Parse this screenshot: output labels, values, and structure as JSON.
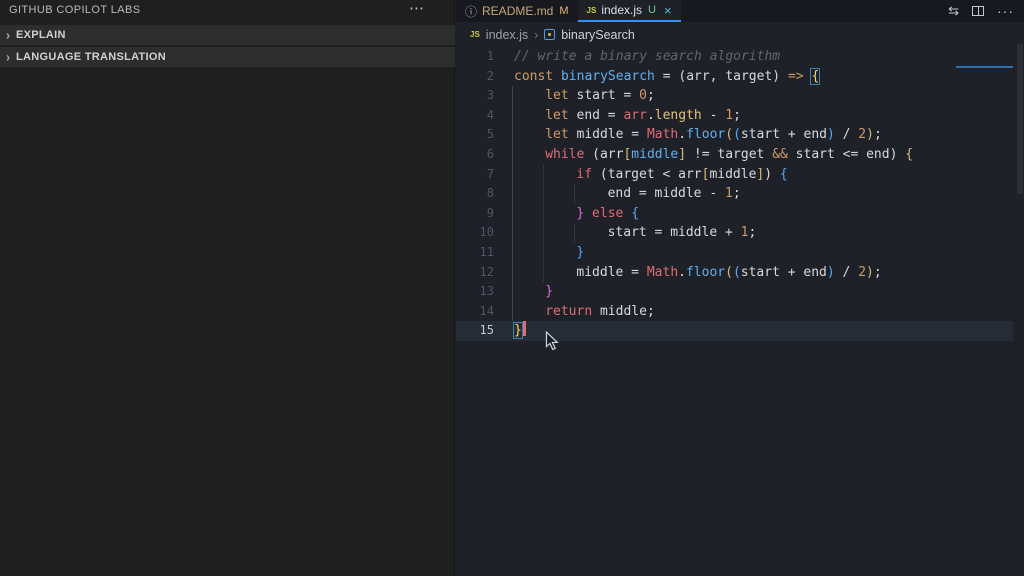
{
  "colors": {
    "accent": "#3193f5",
    "badge_modified": "#dfb77e",
    "badge_untracked": "#73c991",
    "close_icon": "#52b7d7",
    "token": {
      "comment": "#5f6672",
      "keyword": "#d19a66",
      "control": "#e06c75",
      "function": "#61afef",
      "property": "#e5c07b",
      "number": "#d19a66",
      "plain": "#d6d9de",
      "bracket1": "#d7ba7d",
      "bracket2": "#d670d6",
      "bracket3": "#58a6f5",
      "boxed": "#ffd75e",
      "cursor": "#e06c75"
    }
  },
  "sidebar": {
    "title": "GITHUB COPILOT LABS",
    "more_icon": "⋯",
    "chevron_icon": "›",
    "sections": [
      {
        "label": "EXPLAIN"
      },
      {
        "label": "LANGUAGE TRANSLATION"
      }
    ]
  },
  "tabs": [
    {
      "icon": "info",
      "icon_glyph": "ⓘ",
      "label": "README.md",
      "label_color": "#c5a679",
      "badge": "M",
      "badge_color": "#dfb77e",
      "active": false,
      "close": ""
    },
    {
      "icon": "js",
      "icon_glyph": "JS",
      "label": "index.js",
      "label_color": "#dde1e6",
      "badge": "U",
      "badge_color": "#73c991",
      "active": true,
      "close": "×"
    }
  ],
  "editor_actions": {
    "open_changes": "⇆",
    "more": "···"
  },
  "breadcrumb": {
    "file_icon": "JS",
    "file": "index.js",
    "separator": "›",
    "symbol": "binarySearch"
  },
  "code": {
    "active_line": 15,
    "lines": [
      {
        "n": 1,
        "indent": 0,
        "guides": [],
        "caret": false,
        "tokens": [
          [
            "c",
            "// write a binary search algorithm"
          ]
        ]
      },
      {
        "n": 2,
        "indent": 0,
        "guides": [],
        "caret": false,
        "tokens": [
          [
            "kw",
            "const"
          ],
          [
            "pl",
            " "
          ],
          [
            "fn",
            "binarySearch"
          ],
          [
            "pl",
            " = (arr, target) "
          ],
          [
            "kw",
            "=>"
          ],
          [
            "pl",
            " "
          ],
          [
            "box",
            "{"
          ]
        ]
      },
      {
        "n": 3,
        "indent": 4,
        "guides": [
          0
        ],
        "caret": false,
        "tokens": [
          [
            "kw",
            "let"
          ],
          [
            "pl",
            " start = "
          ],
          [
            "num",
            "0"
          ],
          [
            "pl",
            ";"
          ]
        ]
      },
      {
        "n": 4,
        "indent": 4,
        "guides": [
          0
        ],
        "caret": false,
        "tokens": [
          [
            "kw",
            "let"
          ],
          [
            "pl",
            " end = "
          ],
          [
            "ctl",
            "arr"
          ],
          [
            "pl",
            "."
          ],
          [
            "prop",
            "length"
          ],
          [
            "pl",
            " - "
          ],
          [
            "num",
            "1"
          ],
          [
            "pl",
            ";"
          ]
        ]
      },
      {
        "n": 5,
        "indent": 4,
        "guides": [
          0
        ],
        "caret": false,
        "tokens": [
          [
            "kw",
            "let"
          ],
          [
            "pl",
            " middle = "
          ],
          [
            "ctl",
            "Math"
          ],
          [
            "pl",
            "."
          ],
          [
            "fn",
            "floor"
          ],
          [
            "b1",
            "("
          ],
          [
            "b3",
            "("
          ],
          [
            "pl",
            "start + end"
          ],
          [
            "b3",
            ")"
          ],
          [
            "pl",
            " / "
          ],
          [
            "num",
            "2"
          ],
          [
            "b1",
            ")"
          ],
          [
            "pl",
            ";"
          ]
        ]
      },
      {
        "n": 6,
        "indent": 4,
        "guides": [
          0
        ],
        "caret": false,
        "tokens": [
          [
            "ctl",
            "while"
          ],
          [
            "pl",
            " ("
          ],
          [
            "pl",
            "arr"
          ],
          [
            "b1",
            "["
          ],
          [
            "fn",
            "middle"
          ],
          [
            "b1",
            "]"
          ],
          [
            "pl",
            " != target "
          ],
          [
            "kw",
            "&&"
          ],
          [
            "pl",
            " start <= end"
          ],
          [
            "pl",
            ") "
          ],
          [
            "b1",
            "{"
          ]
        ]
      },
      {
        "n": 7,
        "indent": 8,
        "guides": [
          0,
          4
        ],
        "caret": false,
        "tokens": [
          [
            "ctl",
            "if"
          ],
          [
            "pl",
            " (target < arr"
          ],
          [
            "b1",
            "["
          ],
          [
            "pl",
            "middle"
          ],
          [
            "b1",
            "]"
          ],
          [
            "pl",
            ") "
          ],
          [
            "b3",
            "{"
          ]
        ]
      },
      {
        "n": 8,
        "indent": 12,
        "guides": [
          0,
          4,
          8
        ],
        "caret": false,
        "tokens": [
          [
            "pl",
            "end = middle - "
          ],
          [
            "num",
            "1"
          ],
          [
            "pl",
            ";"
          ]
        ]
      },
      {
        "n": 9,
        "indent": 8,
        "guides": [
          0,
          4
        ],
        "caret": false,
        "tokens": [
          [
            "b2",
            "}"
          ],
          [
            "pl",
            " "
          ],
          [
            "ctl",
            "else"
          ],
          [
            "pl",
            " "
          ],
          [
            "b3",
            "{"
          ]
        ]
      },
      {
        "n": 10,
        "indent": 12,
        "guides": [
          0,
          4,
          8
        ],
        "caret": false,
        "tokens": [
          [
            "pl",
            "start = middle + "
          ],
          [
            "num",
            "1"
          ],
          [
            "pl",
            ";"
          ]
        ]
      },
      {
        "n": 11,
        "indent": 8,
        "guides": [
          0,
          4
        ],
        "caret": false,
        "tokens": [
          [
            "b3",
            "}"
          ]
        ]
      },
      {
        "n": 12,
        "indent": 8,
        "guides": [
          0,
          4
        ],
        "caret": false,
        "tokens": [
          [
            "pl",
            "middle = "
          ],
          [
            "ctl",
            "Math"
          ],
          [
            "pl",
            "."
          ],
          [
            "fn",
            "floor"
          ],
          [
            "b1",
            "("
          ],
          [
            "b3",
            "("
          ],
          [
            "pl",
            "start + end"
          ],
          [
            "b3",
            ")"
          ],
          [
            "pl",
            " / "
          ],
          [
            "num",
            "2"
          ],
          [
            "b1",
            ")"
          ],
          [
            "pl",
            ";"
          ]
        ]
      },
      {
        "n": 13,
        "indent": 4,
        "guides": [
          0
        ],
        "caret": false,
        "tokens": [
          [
            "b2",
            "}"
          ]
        ]
      },
      {
        "n": 14,
        "indent": 4,
        "guides": [
          0
        ],
        "caret": false,
        "tokens": [
          [
            "ctl",
            "return"
          ],
          [
            "pl",
            " middle;"
          ]
        ]
      },
      {
        "n": 15,
        "indent": 0,
        "guides": [],
        "caret": true,
        "tokens": [
          [
            "box",
            "}"
          ]
        ]
      }
    ]
  }
}
